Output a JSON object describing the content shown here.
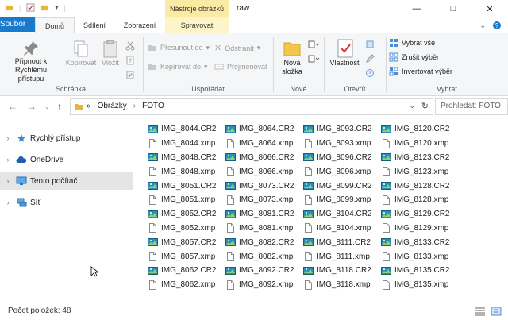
{
  "titlebar": {
    "contextual_tab_title": "Nástroje obrázků",
    "window_title": "raw"
  },
  "tabs": {
    "file": "Soubor",
    "home": "Domů",
    "share": "Sdílení",
    "view": "Zobrazení",
    "manage": "Spravovat"
  },
  "ribbon": {
    "clipboard": {
      "pin": "Připnout k Rychlému přístupu",
      "pin_line1": "Připnout k",
      "pin_line2": "Rychlému přístupu",
      "copy": "Kopírovat",
      "paste": "Vložit",
      "label": "Schránka"
    },
    "organize": {
      "move_to": "Přesunout do",
      "copy_to": "Kopírovat do",
      "delete": "Odstranit",
      "rename": "Přejmenovat",
      "label": "Uspořádat"
    },
    "new": {
      "new_folder_line1": "Nová",
      "new_folder_line2": "složka",
      "label": "Nové"
    },
    "open": {
      "properties": "Vlastnosti",
      "label": "Otevřít"
    },
    "select": {
      "select_all": "Vybrat vše",
      "select_none": "Zrušit výběr",
      "invert": "Invertovat výběr",
      "label": "Vybrat"
    }
  },
  "address": {
    "prefix": "«",
    "crumbs": [
      "Obrázky",
      "FOTO"
    ],
    "search_placeholder": "Prohledat: FOTO"
  },
  "nav": {
    "items": [
      "Rychlý přístup",
      "OneDrive",
      "Tento počítač",
      "Síť"
    ]
  },
  "files": {
    "columns": [
      [
        "IMG_8044.CR2",
        "IMG_8044.xmp",
        "IMG_8048.CR2",
        "IMG_8048.xmp",
        "IMG_8051.CR2",
        "IMG_8051.xmp",
        "IMG_8052.CR2",
        "IMG_8052.xmp",
        "IMG_8057.CR2",
        "IMG_8057.xmp",
        "IMG_8062.CR2",
        "IMG_8062.xmp"
      ],
      [
        "IMG_8064.CR2",
        "IMG_8064.xmp",
        "IMG_8066.CR2",
        "IMG_8066.xmp",
        "IMG_8073.CR2",
        "IMG_8073.xmp",
        "IMG_8081.CR2",
        "IMG_8081.xmp",
        "IMG_8082.CR2",
        "IMG_8082.xmp",
        "IMG_8092.CR2",
        "IMG_8092.xmp"
      ],
      [
        "IMG_8093.CR2",
        "IMG_8093.xmp",
        "IMG_8096.CR2",
        "IMG_8096.xmp",
        "IMG_8099.CR2",
        "IMG_8099.xmp",
        "IMG_8104.CR2",
        "IMG_8104.xmp",
        "IMG_8111.CR2",
        "IMG_8111.xmp",
        "IMG_8118.CR2",
        "IMG_8118.xmp"
      ],
      [
        "IMG_8120.CR2",
        "IMG_8120.xmp",
        "IMG_8123.CR2",
        "IMG_8123.xmp",
        "IMG_8128.CR2",
        "IMG_8128.xmp",
        "IMG_8129.CR2",
        "IMG_8129.xmp",
        "IMG_8133.CR2",
        "IMG_8133.xmp",
        "IMG_8135.CR2",
        "IMG_8135.xmp"
      ]
    ]
  },
  "status": {
    "item_count": "Počet položek: 48"
  },
  "colors": {
    "file_tab": "#1979ca",
    "contextual": "#fbeaa3",
    "nav_selected": "#e5e5e5",
    "raw_icon": "#1f7a9c"
  }
}
